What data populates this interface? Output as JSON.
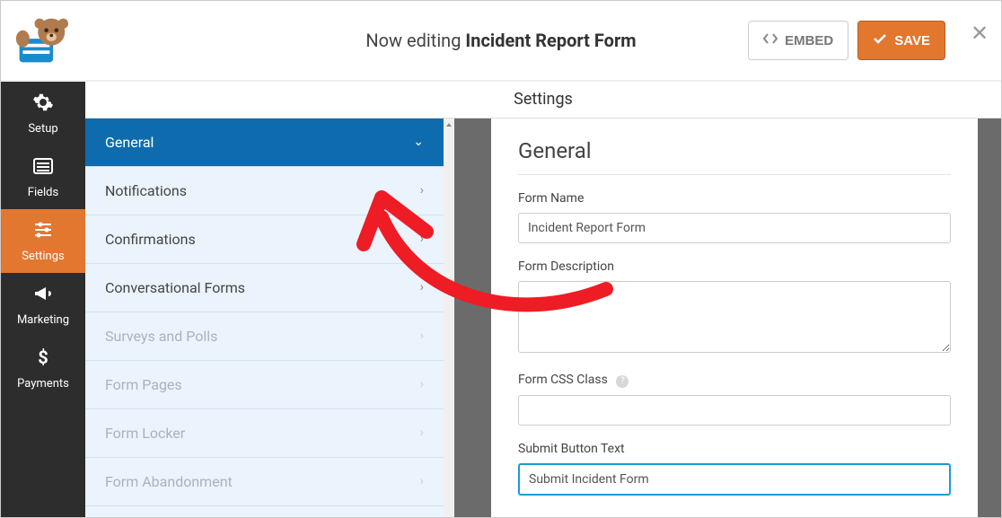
{
  "header": {
    "editing_prefix": "Now editing",
    "form_title": "Incident Report Form",
    "embed_label": "EMBED",
    "save_label": "SAVE"
  },
  "rail": {
    "items": [
      {
        "label": "Setup",
        "icon": "gear"
      },
      {
        "label": "Fields",
        "icon": "list"
      },
      {
        "label": "Settings",
        "icon": "sliders"
      },
      {
        "label": "Marketing",
        "icon": "bullhorn"
      },
      {
        "label": "Payments",
        "icon": "dollar"
      }
    ],
    "active_index": 2
  },
  "panel": {
    "title": "Settings"
  },
  "settings_menu": {
    "items": [
      {
        "label": "General",
        "active": true,
        "expanded": true
      },
      {
        "label": "Notifications"
      },
      {
        "label": "Confirmations"
      },
      {
        "label": "Conversational Forms"
      },
      {
        "label": "Surveys and Polls",
        "disabled": true
      },
      {
        "label": "Form Pages",
        "disabled": true
      },
      {
        "label": "Form Locker",
        "disabled": true
      },
      {
        "label": "Form Abandonment",
        "disabled": true
      }
    ]
  },
  "form": {
    "heading": "General",
    "fields": {
      "form_name": {
        "label": "Form Name",
        "value": "Incident Report Form"
      },
      "form_description": {
        "label": "Form Description",
        "value": ""
      },
      "form_css_class": {
        "label": "Form CSS Class",
        "value": "",
        "help": true
      },
      "submit_button_text": {
        "label": "Submit Button Text",
        "value": "Submit Incident Form",
        "focused": true
      }
    }
  }
}
